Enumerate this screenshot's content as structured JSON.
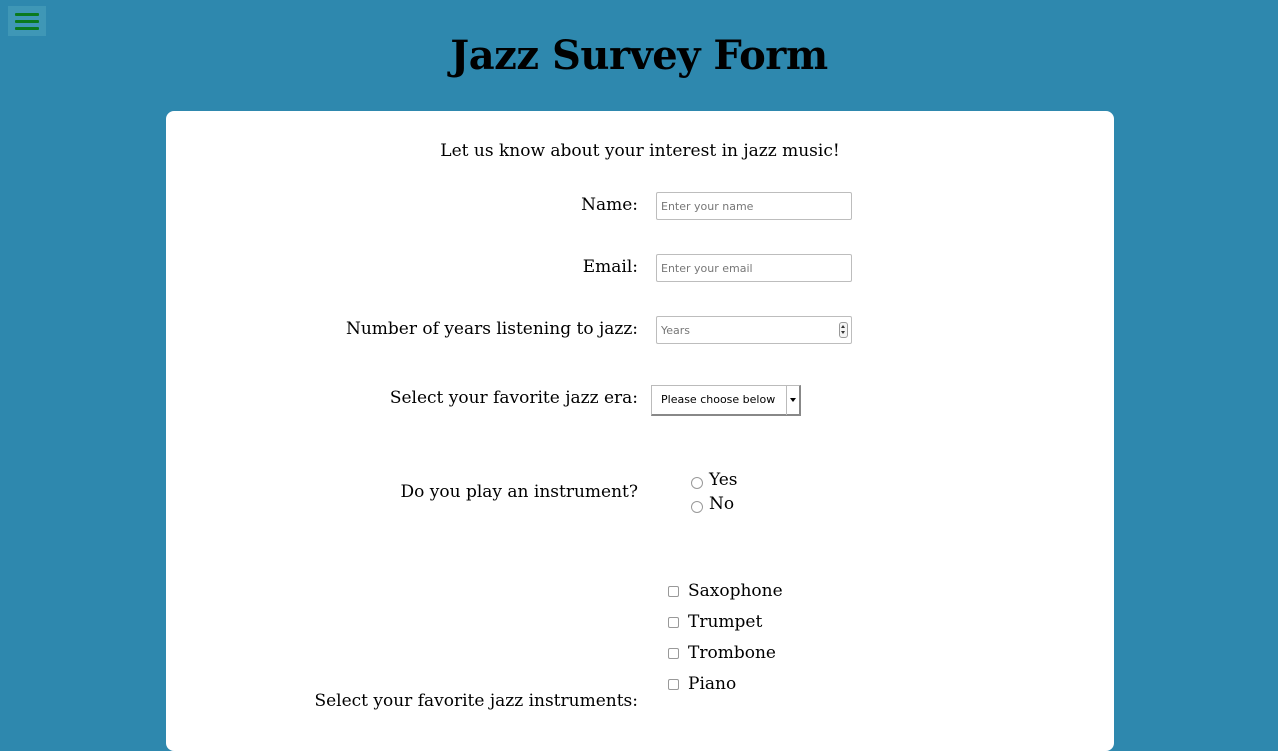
{
  "menu": {
    "icon": "hamburger-menu-icon",
    "icon_color": "#0a7a1e"
  },
  "header": {
    "title": "Jazz Survey Form"
  },
  "colors": {
    "background": "#2e88ae",
    "card": "#ffffff"
  },
  "form": {
    "intro": "Let us know about your interest in jazz music!",
    "name": {
      "label": "Name:",
      "placeholder": "Enter your name",
      "value": ""
    },
    "email": {
      "label": "Email:",
      "placeholder": "Enter your email",
      "value": ""
    },
    "years": {
      "label": "Number of years listening to jazz:",
      "placeholder": "Years",
      "value": ""
    },
    "era": {
      "label": "Select your favorite jazz era:",
      "selected": "Please choose below"
    },
    "plays_instrument": {
      "label": "Do you play an instrument?",
      "options": [
        "Yes",
        "No"
      ]
    },
    "instruments": {
      "label": "Select your favorite jazz instruments:",
      "options": [
        "Saxophone",
        "Trumpet",
        "Trombone",
        "Piano"
      ]
    }
  }
}
